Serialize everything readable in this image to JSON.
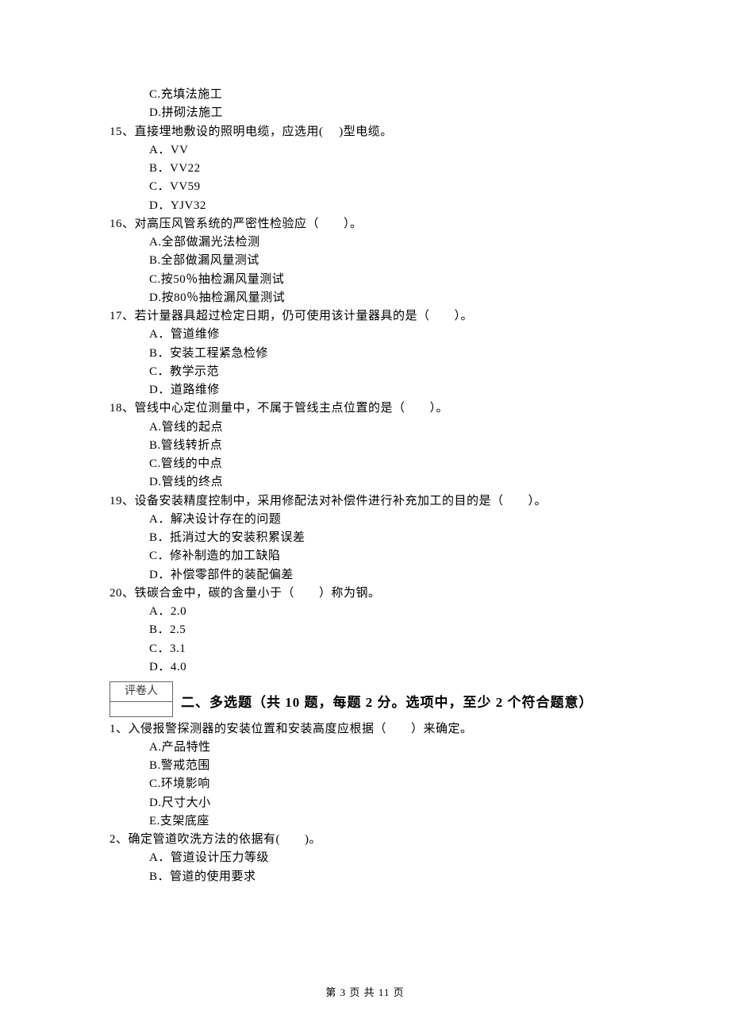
{
  "q14": {
    "optC": "C.充填法施工",
    "optD": "D.拼砌法施工"
  },
  "q15": {
    "stem": "15、直接埋地敷设的照明电缆，应选用(　 )型电缆。",
    "optA": "A．VV",
    "optB": "B．VV22",
    "optC": "C．VV59",
    "optD": "D．YJV32"
  },
  "q16": {
    "stem": "16、对高压风管系统的严密性检验应（　　）。",
    "optA": "A.全部做漏光法检测",
    "optB": "B.全部做漏风量测试",
    "optC": "C.按50％抽检漏风量测试",
    "optD": "D.按80％抽检漏风量测试"
  },
  "q17": {
    "stem": "17、若计量器具超过检定日期，仍可使用该计量器具的是（　　）。",
    "optA": "A．管道维修",
    "optB": "B．安装工程紧急检修",
    "optC": "C．教学示范",
    "optD": "D．道路维修"
  },
  "q18": {
    "stem": "18、管线中心定位测量中，不属于管线主点位置的是（　　）。",
    "optA": "A.管线的起点",
    "optB": "B.管线转折点",
    "optC": "C.管线的中点",
    "optD": "D.管线的终点"
  },
  "q19": {
    "stem": "19、设备安装精度控制中，采用修配法对补偿件进行补充加工的目的是（　　）。",
    "optA": "A．解决设计存在的问题",
    "optB": "B．抵消过大的安装积累误差",
    "optC": "C．修补制造的加工缺陷",
    "optD": "D．补偿零部件的装配偏差"
  },
  "q20": {
    "stem": "20、铁碳合金中，碳的含量小于（　　）称为钢。",
    "optA": "A．2.0",
    "optB": "B．2.5",
    "optC": "C．3.1",
    "optD": "D．4.0"
  },
  "section2": {
    "graderLabel": "评卷人",
    "title": "二、多选题（共 10 题，每题 2 分。选项中，至少 2 个符合题意）"
  },
  "mq1": {
    "stem": "1、入侵报警探测器的安装位置和安装高度应根据（　　）来确定。",
    "optA": "A.产品特性",
    "optB": "B.警戒范围",
    "optC": "C.环境影响",
    "optD": "D.尺寸大小",
    "optE": "E.支架底座"
  },
  "mq2": {
    "stem": "2、确定管道吹洗方法的依据有(　　)。",
    "optA": "A．管道设计压力等级",
    "optB": "B．管道的使用要求"
  },
  "footer": "第 3 页 共 11 页"
}
